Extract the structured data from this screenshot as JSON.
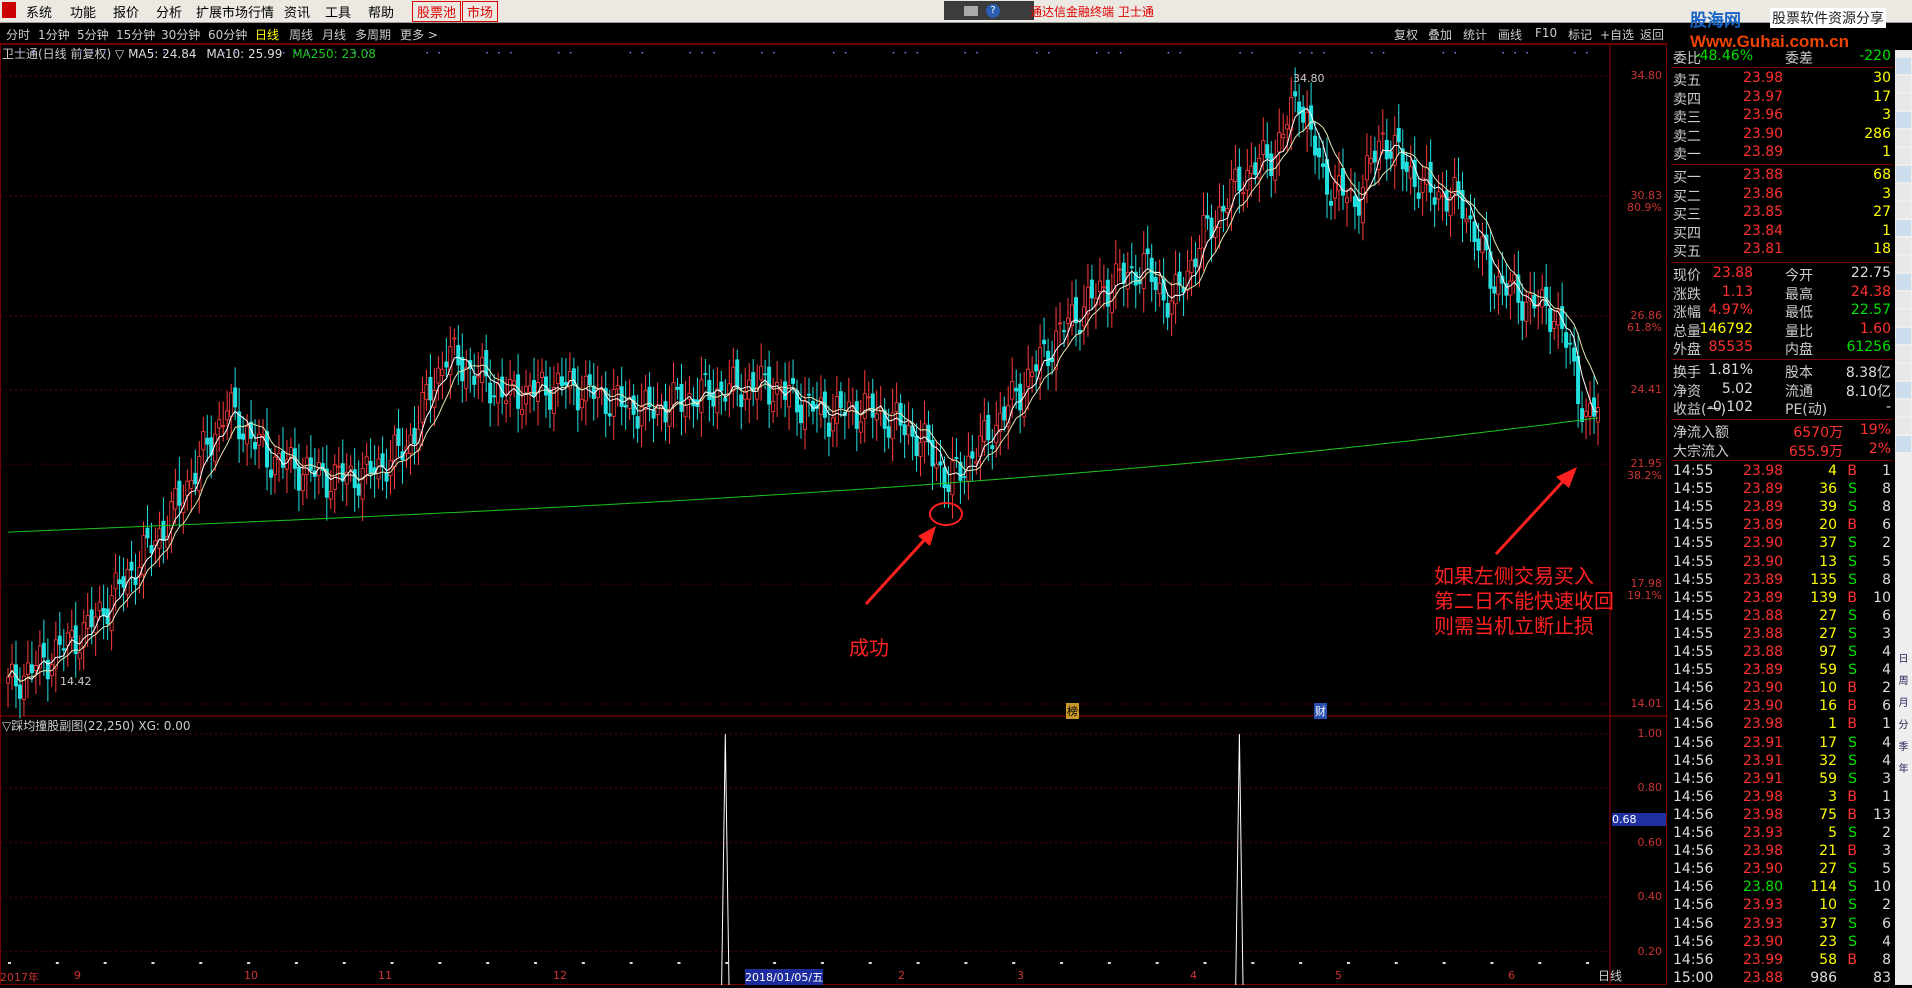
{
  "menu": {
    "items": [
      "系统",
      "功能",
      "报价",
      "分析",
      "扩展市场行情",
      "资讯",
      "工具",
      "帮助"
    ],
    "btn1": "股票池",
    "btn2": "市场",
    "app_title": "通达信金融终端  卫士通",
    "brand_top": "股海网",
    "brand_tag": "股票软件资源分享",
    "brand_url": "Www.Guhai.com.cn"
  },
  "periods": [
    "分时",
    "1分钟",
    "5分钟",
    "15分钟",
    "30分钟",
    "60分钟",
    "日线",
    "周线",
    "月线",
    "多周期",
    "更多 >"
  ],
  "active_period": "日线",
  "right_buttons": [
    "复权",
    "叠加",
    "统计",
    "画线",
    "F10",
    "标记",
    "+自选",
    "返回"
  ],
  "info": {
    "name": "卫士通(日线 前复权)",
    "ma5": "MA5: 24.84",
    "ma10": "MA10: 25.99",
    "ma250": "MA250: 23.08"
  },
  "sub_info": "▽踩均撞股副图(22,250)  XG: 0.00",
  "chart_data": {
    "type": "candlestick",
    "ylim": [
      14.01,
      34.8
    ],
    "yticks": [
      {
        "v": "34.80",
        "p": ""
      },
      {
        "v": "30.83",
        "p": "80.9%"
      },
      {
        "v": "26.86",
        "p": "61.8%"
      },
      {
        "v": "24.41",
        "p": ""
      },
      {
        "v": "21.95",
        "p": "38.2%"
      },
      {
        "v": "17.98",
        "p": "19.1%"
      },
      {
        "v": "14.01",
        "p": ""
      }
    ],
    "high_label": "34.80",
    "low_label": "14.42",
    "x_labels": [
      "2017年",
      "9",
      "10",
      "11",
      "12",
      "2018/01/05/五",
      "2",
      "3",
      "4",
      "5",
      "6"
    ],
    "markers": [
      "榜",
      "财"
    ],
    "subchart": {
      "ylim": [
        0,
        1
      ],
      "yticks": [
        "1.00",
        "0.80",
        "0.60",
        "0.40",
        "0.20"
      ],
      "current": "0.68",
      "spike_days": [
        144,
        247
      ]
    }
  },
  "annotations": {
    "success": "成功",
    "note_line1": "如果左侧交易买入",
    "note_line2": "第二日不能快速收回",
    "note_line3": "则需当机立断止损"
  },
  "quote": {
    "top": {
      "label": "委比",
      "value": "-48.46%",
      "label2": "委差",
      "value2": "-220"
    },
    "asks": [
      {
        "label": "卖五",
        "price": "23.98",
        "vol": "30"
      },
      {
        "label": "卖四",
        "price": "23.97",
        "vol": "17"
      },
      {
        "label": "卖三",
        "price": "23.96",
        "vol": "3"
      },
      {
        "label": "卖二",
        "price": "23.90",
        "vol": "286"
      },
      {
        "label": "卖一",
        "price": "23.89",
        "vol": "1"
      }
    ],
    "bids": [
      {
        "label": "买一",
        "price": "23.88",
        "vol": "68"
      },
      {
        "label": "买二",
        "price": "23.86",
        "vol": "3"
      },
      {
        "label": "买三",
        "price": "23.85",
        "vol": "27"
      },
      {
        "label": "买四",
        "price": "23.84",
        "vol": "1"
      },
      {
        "label": "买五",
        "price": "23.81",
        "vol": "18"
      }
    ],
    "stats": [
      {
        "l1": "现价",
        "v1": "23.88",
        "c1": "red",
        "l2": "今开",
        "v2": "22.75",
        "c2": "wht"
      },
      {
        "l1": "涨跌",
        "v1": "1.13",
        "c1": "red",
        "l2": "最高",
        "v2": "24.38",
        "c2": "red"
      },
      {
        "l1": "涨幅",
        "v1": "4.97%",
        "c1": "red",
        "l2": "最低",
        "v2": "22.57",
        "c2": "grn"
      },
      {
        "l1": "总量",
        "v1": "146792",
        "c1": "yel",
        "l2": "量比",
        "v2": "1.60",
        "c2": "red"
      },
      {
        "l1": "外盘",
        "v1": "85535",
        "c1": "red",
        "l2": "内盘",
        "v2": "61256",
        "c2": "grn"
      }
    ],
    "stats2": [
      {
        "l1": "换手",
        "v1": "1.81%",
        "l2": "股本",
        "v2": "8.38亿"
      },
      {
        "l1": "净资",
        "v1": "5.02",
        "l2": "流通",
        "v2": "8.10亿"
      },
      {
        "l1": "收益(一)",
        "v1": "-0.102",
        "l2": "PE(动)",
        "v2": "-"
      }
    ],
    "flows": [
      {
        "label": "净流入额",
        "value": "6570万",
        "pct": "19%"
      },
      {
        "label": "大宗流入",
        "value": "655.9万",
        "pct": "2%"
      }
    ],
    "ticks": [
      [
        "14:55",
        "23.98",
        "4",
        "B",
        "1"
      ],
      [
        "14:55",
        "23.89",
        "36",
        "S",
        "8"
      ],
      [
        "14:55",
        "23.89",
        "39",
        "S",
        "8"
      ],
      [
        "14:55",
        "23.89",
        "20",
        "B",
        "6"
      ],
      [
        "14:55",
        "23.90",
        "37",
        "S",
        "2"
      ],
      [
        "14:55",
        "23.90",
        "13",
        "S",
        "5"
      ],
      [
        "14:55",
        "23.89",
        "135",
        "S",
        "8"
      ],
      [
        "14:55",
        "23.89",
        "139",
        "B",
        "10"
      ],
      [
        "14:55",
        "23.88",
        "27",
        "S",
        "6"
      ],
      [
        "14:55",
        "23.88",
        "27",
        "S",
        "3"
      ],
      [
        "14:55",
        "23.88",
        "97",
        "S",
        "4"
      ],
      [
        "14:55",
        "23.89",
        "59",
        "S",
        "4"
      ],
      [
        "14:56",
        "23.90",
        "10",
        "B",
        "2"
      ],
      [
        "14:56",
        "23.90",
        "16",
        "B",
        "6"
      ],
      [
        "14:56",
        "23.98",
        "1",
        "B",
        "1"
      ],
      [
        "14:56",
        "23.91",
        "17",
        "S",
        "4"
      ],
      [
        "14:56",
        "23.91",
        "32",
        "S",
        "4"
      ],
      [
        "14:56",
        "23.91",
        "59",
        "S",
        "3"
      ],
      [
        "14:56",
        "23.98",
        "3",
        "B",
        "1"
      ],
      [
        "14:56",
        "23.98",
        "75",
        "B",
        "13"
      ],
      [
        "14:56",
        "23.93",
        "5",
        "S",
        "2"
      ],
      [
        "14:56",
        "23.98",
        "21",
        "B",
        "3"
      ],
      [
        "14:56",
        "23.90",
        "27",
        "S",
        "5"
      ],
      [
        "14:56",
        "23.80",
        "114",
        "S",
        "10"
      ],
      [
        "14:56",
        "23.93",
        "10",
        "S",
        "2"
      ],
      [
        "14:56",
        "23.93",
        "37",
        "S",
        "6"
      ],
      [
        "14:56",
        "23.90",
        "23",
        "S",
        "4"
      ],
      [
        "14:56",
        "23.99",
        "58",
        "B",
        "8"
      ],
      [
        "15:00",
        "23.88",
        "986",
        "",
        "83"
      ]
    ],
    "bottom_tab": "日线"
  },
  "sidebar_icons": [
    "日",
    "周",
    "月",
    "分",
    "季",
    "年"
  ]
}
